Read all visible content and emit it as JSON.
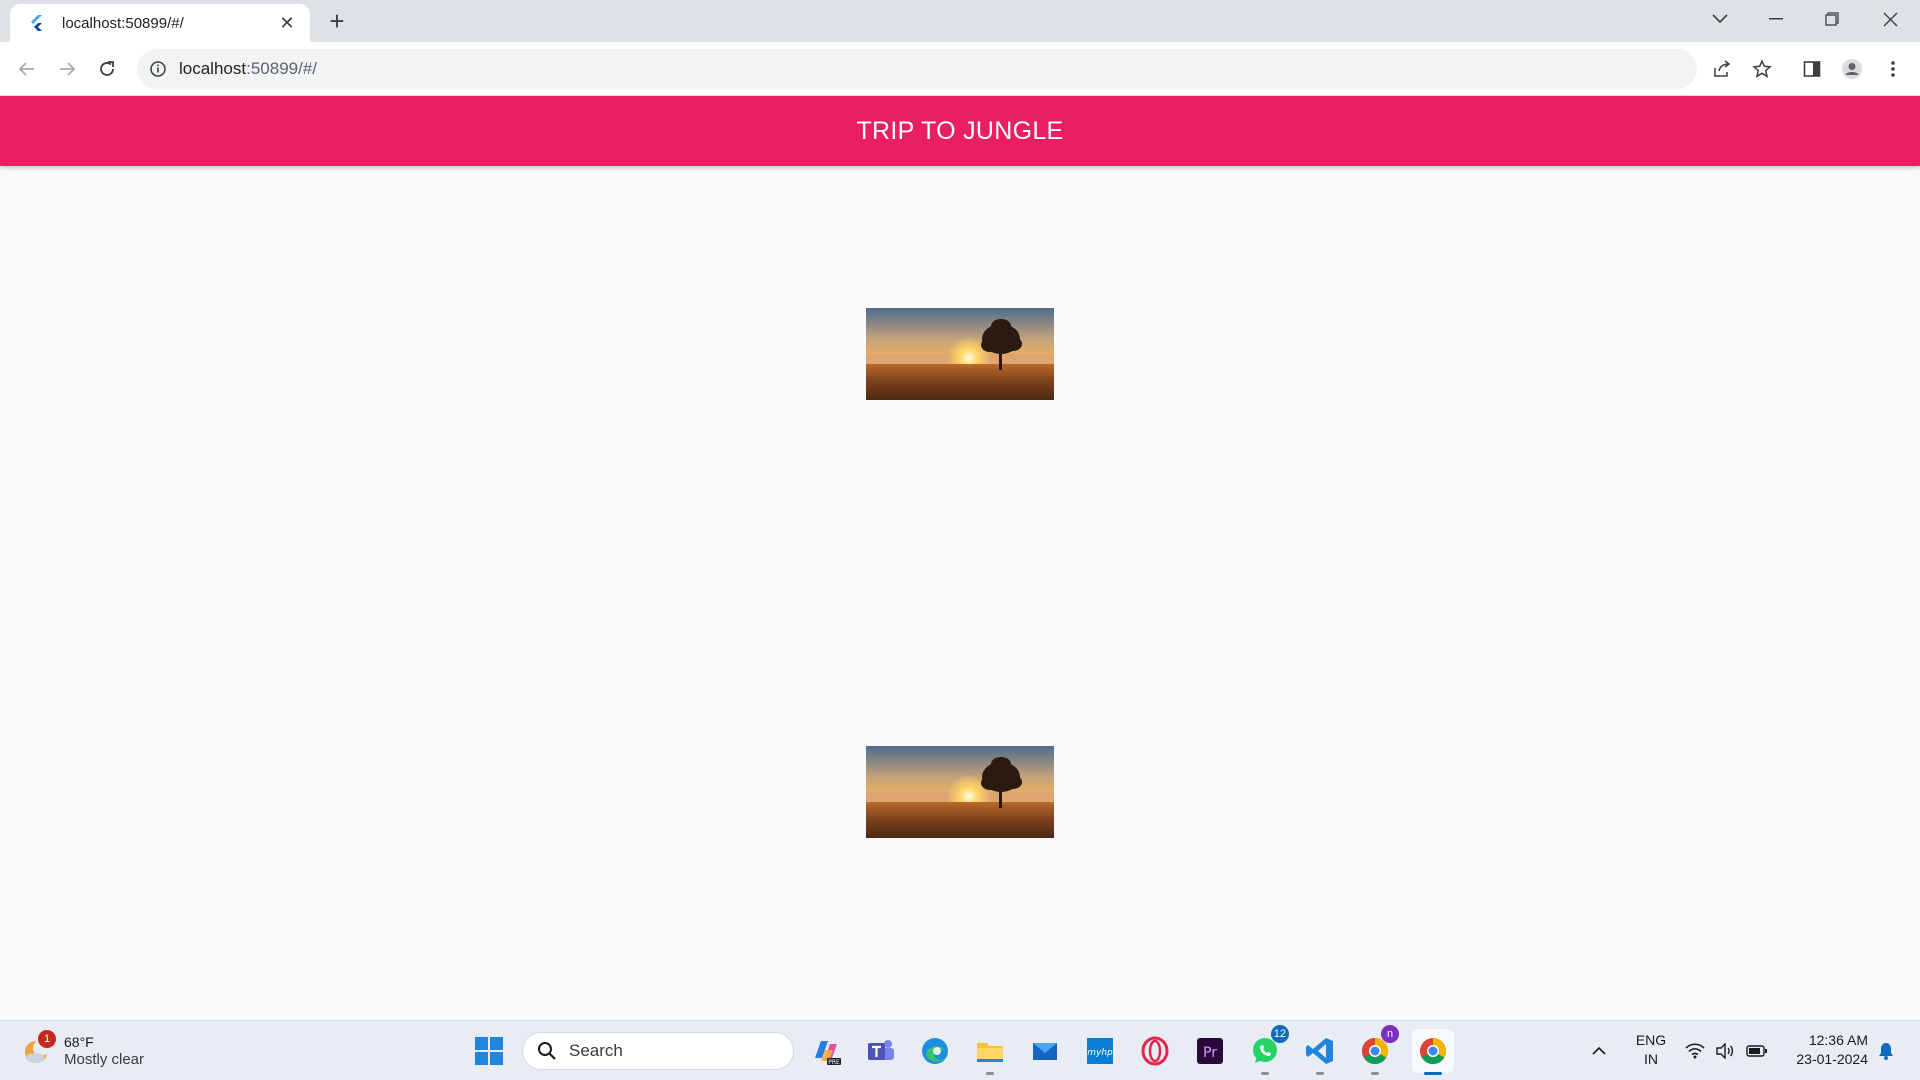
{
  "browser": {
    "tab_title": "localhost:50899/#/",
    "tab_close": "✕",
    "new_tab": "+",
    "url_host": "localhost",
    "url_path": ":50899/#/"
  },
  "app": {
    "title": "TRIP TO JUNGLE",
    "images": [
      {
        "alt": "tree at sunrise in a misty field"
      },
      {
        "alt": "tree at sunrise in a misty field"
      }
    ],
    "colors": {
      "appbar": "#e91e63",
      "background": "#fafafa"
    }
  },
  "taskbar": {
    "weather": {
      "badge": "1",
      "temp": "68°F",
      "condition": "Mostly clear"
    },
    "search_placeholder": "Search",
    "badges": {
      "whatsapp": "12",
      "chrome_profile": "n"
    },
    "tray": {
      "lang": "ENG",
      "region": "IN",
      "time": "12:36 AM",
      "date": "23-01-2024"
    }
  }
}
